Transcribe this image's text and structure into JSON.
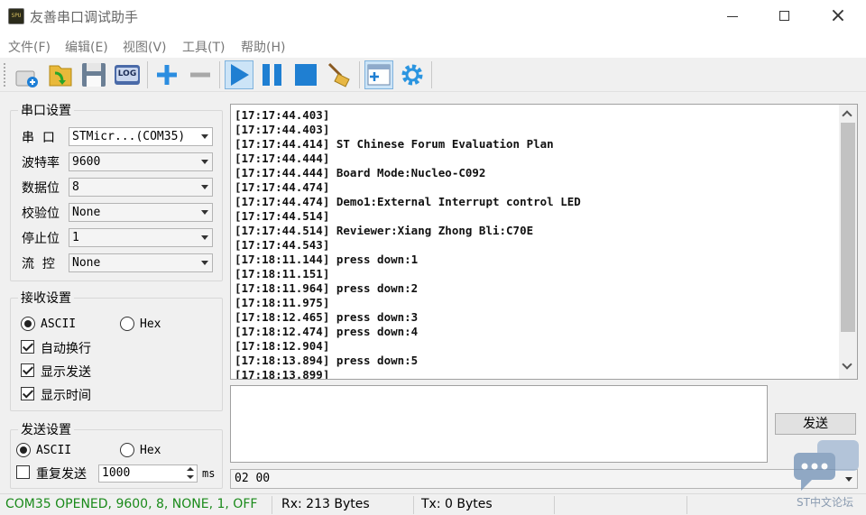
{
  "app": {
    "title": "友善串口调试助手",
    "icon_text": "SPU"
  },
  "window_controls": {
    "minimize": "minimize-icon",
    "maximize": "maximize-icon",
    "close": "×"
  },
  "menu": [
    {
      "label": "文件(F)"
    },
    {
      "label": "编辑(E)"
    },
    {
      "label": "视图(V)"
    },
    {
      "label": "工具(T)"
    },
    {
      "label": "帮助(H)"
    }
  ],
  "toolbar": {
    "log_label": "LOG",
    "icons": [
      "new-port-icon",
      "open-folder-icon",
      "save-icon",
      "log-icon",
      "add-icon",
      "remove-icon",
      "play-icon",
      "pause-icon",
      "stop-icon",
      "broom-icon",
      "add-window-icon",
      "gear-icon"
    ],
    "active": [
      "play-icon",
      "add-window-icon"
    ]
  },
  "serial": {
    "group_title": "串口设置",
    "port_label": "串  口",
    "port_value": "STMicr...(COM35)",
    "baud_label": "波特率",
    "baud_value": "9600",
    "databits_label": "数据位",
    "databits_value": "8",
    "parity_label": "校验位",
    "parity_value": "None",
    "stopbits_label": "停止位",
    "stopbits_value": "1",
    "flow_label": "流  控",
    "flow_value": "None"
  },
  "receive": {
    "group_title": "接收设置",
    "ascii_label": "ASCII",
    "hex_label": "Hex",
    "mode": "ASCII",
    "auto_wrap_label": "自动换行",
    "auto_wrap": true,
    "show_send_label": "显示发送",
    "show_send": true,
    "show_time_label": "显示时间",
    "show_time": true
  },
  "send": {
    "group_title": "发送设置",
    "ascii_label": "ASCII",
    "hex_label": "Hex",
    "mode": "ASCII",
    "repeat_label": "重复发送",
    "repeat": false,
    "interval": "1000",
    "interval_unit": "ms",
    "button_label": "发送",
    "history_value": "02 00"
  },
  "log_lines": [
    "[17:17:44.403]",
    "[17:17:44.403]",
    "[17:17:44.414] ST Chinese Forum Evaluation Plan",
    "[17:17:44.444]",
    "[17:17:44.444] Board Mode:Nucleo-C092",
    "[17:17:44.474]",
    "[17:17:44.474] Demo1:External Interrupt control LED",
    "[17:17:44.514]",
    "[17:17:44.514] Reviewer:Xiang Zhong Bli:C70E",
    "[17:17:44.543]",
    "[17:18:11.144] press down:1",
    "[17:18:11.151]",
    "[17:18:11.964] press down:2",
    "[17:18:11.975]",
    "[17:18:12.465] press down:3",
    "[17:18:12.474] press down:4",
    "[17:18:12.904]",
    "[17:18:13.894] press down:5",
    "[17:18:13.899]"
  ],
  "status": {
    "connection": "COM35 OPENED, 9600, 8, NONE, 1, OFF",
    "rx": "Rx: 213 Bytes",
    "tx": "Tx: 0 Bytes",
    "connection_color": "#1a8a1a"
  },
  "watermark": {
    "text": "ST中文论坛"
  }
}
